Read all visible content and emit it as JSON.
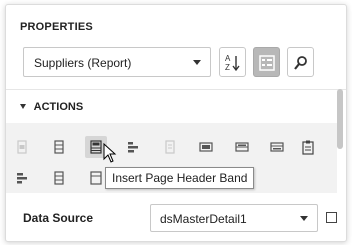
{
  "panel": {
    "title": "PROPERTIES",
    "component_select": {
      "value": "Suppliers (Report)"
    },
    "toolbar": {
      "sort_icon": "sort-az-icon",
      "categories_icon": "categories-icon",
      "search_icon": "search-icon"
    }
  },
  "actions": {
    "section_label": "ACTIONS",
    "tooltip": "Insert Page Header Band",
    "icons": [
      "band-icon",
      "band-icon",
      "band-icon",
      "band-icon",
      "band-icon",
      "band-icon",
      "band-icon",
      "band-icon",
      "band-icon",
      "band-icon",
      "band-icon",
      "band-icon"
    ]
  },
  "data_source": {
    "label": "Data Source",
    "value": "dsMasterDetail1"
  },
  "colors": {
    "accent_active": "#b8b8b8",
    "actions_bg": "#f2f2f2",
    "text": "#222222"
  }
}
